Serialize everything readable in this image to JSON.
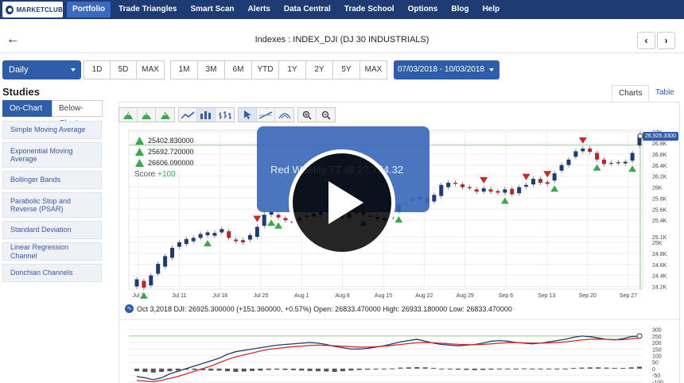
{
  "nav": {
    "logo": "MARKETCLUB",
    "items": [
      "Portfolio",
      "Trade Triangles",
      "Smart Scan",
      "Alerts",
      "Data Central",
      "Trade School",
      "Options",
      "Blog",
      "Help"
    ],
    "active": "Portfolio"
  },
  "header": {
    "title": "Indexes : INDEX_DJI (DJ 30 INDUSTRIALS)",
    "back_icon": "arrow-left-icon",
    "prev_icon": "chevron-left-icon",
    "next_icon": "chevron-right-icon"
  },
  "toolbar": {
    "period": "Daily",
    "intraday_ranges": [
      "1D",
      "5D",
      "MAX"
    ],
    "ranges": [
      "1M",
      "3M",
      "6M",
      "YTD",
      "1Y",
      "2Y",
      "5Y",
      "MAX"
    ],
    "date_range": "07/03/2018 - 10/03/2018"
  },
  "studies": {
    "title": "Studies",
    "tabs": [
      "On-Chart",
      "Below-Chart"
    ],
    "active_tab": "On-Chart",
    "items": [
      "Simple Moving Average",
      "Exponential Moving Average",
      "Bollinger Bands",
      "Parabolic Stop and Reverse (PSAR)",
      "Standard Deviation",
      "Linear Regression Channel",
      "Donchian Channels"
    ]
  },
  "chart_tabs": [
    "Charts",
    "Table"
  ],
  "chart_tools": {
    "triangle_letters": [
      "M",
      "W",
      "D"
    ],
    "icons": [
      "line-chart-icon",
      "bar-chart-icon",
      "ohlc-chart-icon",
      "cursor-icon",
      "trend-line-icon",
      "zoom-in-icon",
      "zoom-out-icon"
    ]
  },
  "signals": {
    "values": [
      "25402.830000",
      "25692.720000",
      "26606.090000"
    ],
    "score_label": "Score",
    "score_value": "+100"
  },
  "info_line": "Oct 3,2018 DJI: 26925.300000 (+151.360000, +0.57%) Open: 26833.470000 High: 26933.180000 Low: 26833.470000",
  "price_label": "26,925.3300",
  "video": {
    "title": "Red Weekly TT @ 2?,754.32"
  },
  "chart_data": [
    {
      "type": "candlestick",
      "x_ticks": [
        "Jul 3",
        "Jul 11",
        "Jul 18",
        "Jul 25",
        "Aug 1",
        "Aug 8",
        "Aug 15",
        "Aug 22",
        "Aug 29",
        "Sep 6",
        "Sep 13",
        "Sep 20",
        "Sep 27"
      ],
      "y_ticks": [
        "24.2K",
        "24.4K",
        "24.6K",
        "24.8K",
        "25K",
        "25.1K",
        "25.4K",
        "25.6K",
        "25.8K",
        "26K",
        "26.2K",
        "26.4K",
        "26.6K",
        "26.8K",
        "27K"
      ],
      "ylim": [
        24150,
        27030
      ],
      "candles": [
        [
          24200,
          24330
        ],
        [
          24300,
          24180
        ],
        [
          24220,
          24400
        ],
        [
          24430,
          24610
        ],
        [
          24560,
          24750
        ],
        [
          24720,
          24900
        ],
        [
          24920,
          25000
        ],
        [
          24970,
          25060
        ],
        [
          25020,
          25080
        ],
        [
          25080,
          25150
        ],
        [
          25130,
          25180
        ],
        [
          25120,
          25170
        ],
        [
          25180,
          25240
        ],
        [
          25200,
          25080
        ],
        [
          25050,
          25020
        ],
        [
          25040,
          25000
        ],
        [
          25050,
          25130
        ],
        [
          25100,
          25280
        ],
        [
          25300,
          25500
        ],
        [
          25500,
          25560
        ],
        [
          25500,
          25450
        ],
        [
          25440,
          25400
        ],
        [
          25380,
          25380
        ],
        [
          25400,
          25440
        ],
        [
          25460,
          25480
        ],
        [
          25470,
          25520
        ],
        [
          25500,
          25560
        ],
        [
          25560,
          25620
        ],
        [
          25580,
          25520
        ],
        [
          25500,
          25440
        ],
        [
          25450,
          25530
        ],
        [
          25530,
          25590
        ],
        [
          25560,
          25500
        ],
        [
          25480,
          25460
        ],
        [
          25460,
          25420
        ],
        [
          25400,
          25440
        ],
        [
          25420,
          25560
        ],
        [
          25560,
          25680
        ],
        [
          25700,
          25700
        ],
        [
          25760,
          25780
        ],
        [
          25780,
          25820
        ],
        [
          25800,
          25720
        ],
        [
          25740,
          25860
        ],
        [
          25840,
          26040
        ],
        [
          26000,
          26080
        ],
        [
          26080,
          26060
        ],
        [
          26050,
          26000
        ],
        [
          26000,
          25980
        ],
        [
          25960,
          25920
        ],
        [
          25920,
          25980
        ],
        [
          25960,
          25920
        ],
        [
          25930,
          25900
        ],
        [
          25900,
          25960
        ],
        [
          25970,
          25870
        ],
        [
          25890,
          26000
        ],
        [
          26010,
          26040
        ],
        [
          26050,
          26150
        ],
        [
          26150,
          26080
        ],
        [
          26090,
          26060
        ],
        [
          26120,
          26250
        ],
        [
          26300,
          26400
        ],
        [
          26400,
          26500
        ],
        [
          26550,
          26650
        ],
        [
          26650,
          26700
        ],
        [
          26700,
          26640
        ],
        [
          26620,
          26500
        ],
        [
          26500,
          26420
        ],
        [
          26440,
          26430
        ],
        [
          26440,
          26450
        ],
        [
          26430,
          26460
        ],
        [
          26480,
          26620
        ],
        [
          26760,
          26925
        ]
      ],
      "triangles": [
        {
          "candle": 1,
          "dir": "up"
        },
        {
          "candle": 10,
          "dir": "up"
        },
        {
          "candle": 17,
          "dir": "down"
        },
        {
          "candle": 19,
          "dir": "up"
        },
        {
          "candle": 20,
          "dir": "up"
        },
        {
          "candle": 32,
          "dir": "up"
        },
        {
          "candle": 37,
          "dir": "up"
        },
        {
          "candle": 49,
          "dir": "down"
        },
        {
          "candle": 52,
          "dir": "up"
        },
        {
          "candle": 55,
          "dir": "down"
        },
        {
          "candle": 58,
          "dir": "down"
        },
        {
          "candle": 59,
          "dir": "up"
        },
        {
          "candle": 63,
          "dir": "down"
        },
        {
          "candle": 65,
          "dir": "up"
        },
        {
          "candle": 70,
          "dir": "up"
        }
      ],
      "reference_line": 26760
    },
    {
      "type": "line+bar",
      "y_ticks": [
        "300",
        "250",
        "200",
        "150",
        "100",
        "50",
        "0",
        "-50",
        "-100"
      ],
      "ylim": [
        -110,
        310
      ],
      "series": [
        {
          "values": [
            -60,
            -70,
            -85,
            -70,
            -40,
            -20,
            0,
            20,
            40,
            60,
            80,
            110,
            130,
            140,
            150,
            160,
            170,
            180,
            185,
            190,
            195,
            200,
            195,
            185,
            170,
            160,
            150,
            150,
            155,
            165,
            175,
            190,
            205,
            215,
            225,
            210,
            195,
            185,
            180,
            175,
            180,
            185,
            195,
            210,
            215,
            210,
            200,
            195,
            190,
            195,
            205,
            215,
            225,
            240,
            250,
            245,
            235,
            225,
            220,
            230,
            245,
            250
          ]
        },
        {
          "values": [
            -90,
            -95,
            -100,
            -90,
            -75,
            -60,
            -40,
            -20,
            0,
            20,
            45,
            70,
            90,
            105,
            120,
            135,
            148,
            155,
            162,
            168,
            172,
            178,
            180,
            178,
            175,
            172,
            168,
            165,
            165,
            168,
            172,
            178,
            185,
            192,
            198,
            200,
            198,
            194,
            190,
            186,
            184,
            183,
            185,
            190,
            195,
            198,
            200,
            198,
            196,
            195,
            197,
            200,
            205,
            212,
            220,
            225,
            226,
            225,
            222,
            222,
            228,
            235
          ]
        }
      ],
      "bars": [
        -20,
        -25,
        -30,
        -25,
        -20,
        -15,
        -8,
        -10,
        -12,
        -15,
        -15,
        -20,
        -25,
        -22,
        -18,
        -15,
        -10,
        -8,
        -10,
        -12,
        -15,
        -18,
        -20,
        -22,
        -25,
        -20,
        -15,
        -10,
        -8,
        -5,
        -3,
        2,
        8,
        10,
        12,
        10,
        5,
        0,
        -5,
        -8,
        -10,
        -12,
        -10,
        -8,
        -5,
        -3,
        0,
        2,
        0,
        -5,
        -5,
        -3,
        0,
        5,
        8,
        10,
        10,
        8,
        6,
        5,
        10,
        15
      ],
      "reference_line": 250
    }
  ]
}
